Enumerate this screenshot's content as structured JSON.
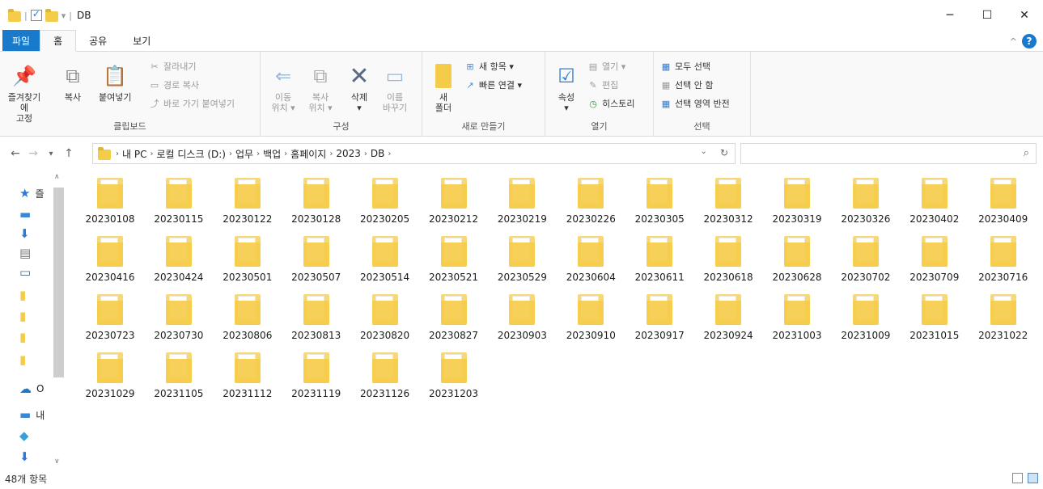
{
  "window": {
    "title": "DB"
  },
  "ribbon_tabs": [
    "파일",
    "홈",
    "공유",
    "보기"
  ],
  "clipboard": {
    "pin_label_1": "즐겨찾기에",
    "pin_label_2": "고정",
    "copy": "복사",
    "paste": "붙여넣기",
    "cut": "잘라내기",
    "copy_path": "경로 복사",
    "paste_shortcut": "바로 가기 붙여넣기",
    "group": "클립보드"
  },
  "organize": {
    "move_1": "이동",
    "move_2": "위치 ▾",
    "copyto_1": "복사",
    "copyto_2": "위치 ▾",
    "delete": "삭제",
    "rename_1": "이름",
    "rename_2": "바꾸기",
    "group": "구성"
  },
  "new": {
    "new_folder_1": "새",
    "new_folder_2": "폴더",
    "new_item": "새 항목 ▾",
    "easy_access": "빠른 연결 ▾",
    "group": "새로 만들기"
  },
  "open": {
    "properties": "속성",
    "open": "열기 ▾",
    "edit": "편집",
    "history": "히스토리",
    "group": "열기"
  },
  "select": {
    "select_all": "모두 선택",
    "select_none": "선택 안 함",
    "invert": "선택 영역 반전",
    "group": "선택"
  },
  "breadcrumb": [
    "내 PC",
    "로컬 디스크 (D:)",
    "업무",
    "백업",
    "홈페이지",
    "2023",
    "DB"
  ],
  "nav_pane": [
    {
      "label": "즐",
      "icon": "star-icon"
    },
    {
      "label": "",
      "icon": "desktop-icon"
    },
    {
      "label": "",
      "icon": "download-icon"
    },
    {
      "label": "",
      "icon": "document-icon"
    },
    {
      "label": "",
      "icon": "picture-icon"
    },
    {
      "label": "",
      "icon": "folder-icon"
    },
    {
      "label": "",
      "icon": "folder-icon"
    },
    {
      "label": "",
      "icon": "folder-icon"
    },
    {
      "label": "",
      "icon": "folder-icon"
    },
    {
      "label": "O",
      "icon": "onedrive-icon"
    },
    {
      "label": "내",
      "icon": "pc-icon"
    },
    {
      "label": "",
      "icon": "3d-objects-icon"
    },
    {
      "label": "",
      "icon": "download-icon"
    }
  ],
  "folders": [
    "20230108",
    "20230115",
    "20230122",
    "20230128",
    "20230205",
    "20230212",
    "20230219",
    "20230226",
    "20230305",
    "20230312",
    "20230319",
    "20230326",
    "20230402",
    "20230409",
    "20230416",
    "20230424",
    "20230501",
    "20230507",
    "20230514",
    "20230521",
    "20230529",
    "20230604",
    "20230611",
    "20230618",
    "20230628",
    "20230702",
    "20230709",
    "20230716",
    "20230723",
    "20230730",
    "20230806",
    "20230813",
    "20230820",
    "20230827",
    "20230903",
    "20230910",
    "20230917",
    "20230924",
    "20231003",
    "20231009",
    "20231015",
    "20231022",
    "20231029",
    "20231105",
    "20231112",
    "20231119",
    "20231126",
    "20231203"
  ],
  "status": {
    "item_count": "48개 항목"
  },
  "colors": {
    "accent": "#1979ca",
    "folder": "#f5cc4a"
  }
}
